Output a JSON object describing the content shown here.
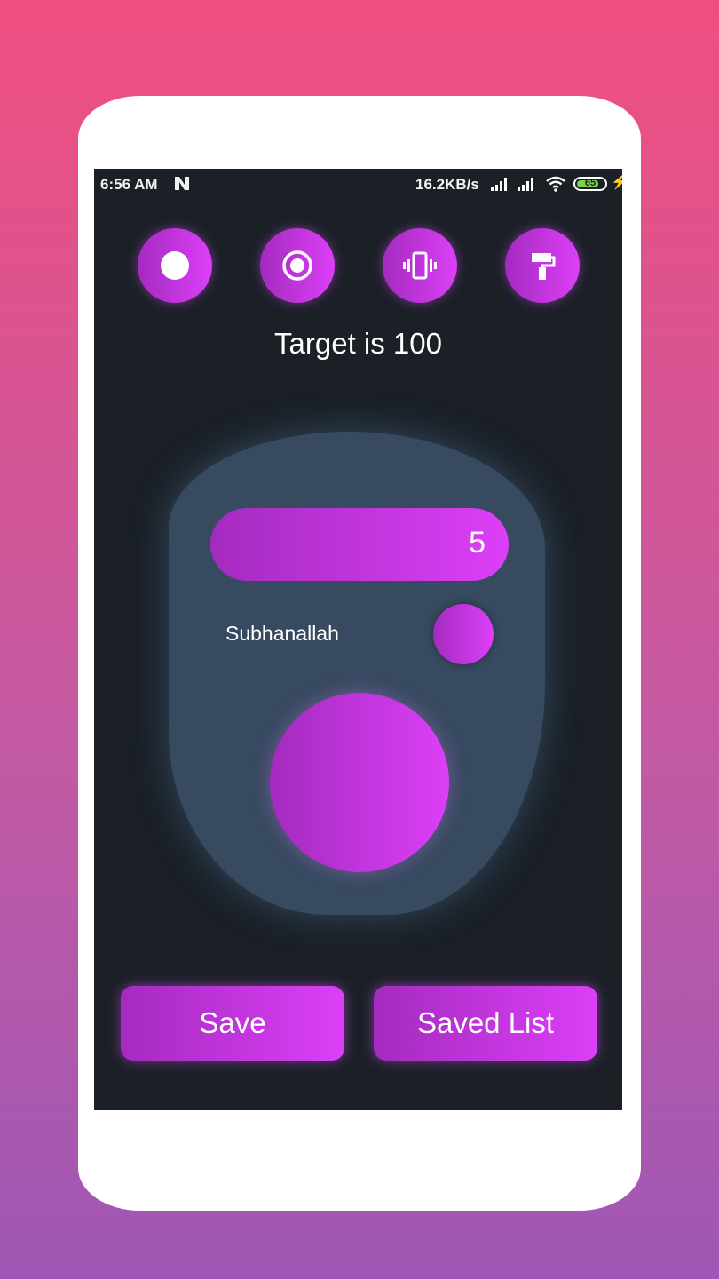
{
  "status_bar": {
    "time": "6:56 AM",
    "network_speed": "16.2KB/s",
    "battery_level": "65",
    "icons": [
      "n-notification-icon",
      "signal-icon",
      "signal-icon",
      "wifi-icon",
      "battery-icon",
      "charging-bolt-icon"
    ]
  },
  "toolbar": {
    "buttons": [
      {
        "icon": "filled-circle-icon"
      },
      {
        "icon": "radio-target-icon"
      },
      {
        "icon": "vibrate-icon"
      },
      {
        "icon": "paint-roller-icon"
      }
    ]
  },
  "target_text": "Target is 100",
  "counter": {
    "count": "5",
    "dhikr_label": "Subhanallah"
  },
  "actions": {
    "save_label": "Save",
    "saved_list_label": "Saved List"
  },
  "colors": {
    "accent_start": "#a42bbf",
    "accent_end": "#dc3ff7",
    "screen_bg": "#1b2027",
    "device_body": "#374a60"
  }
}
